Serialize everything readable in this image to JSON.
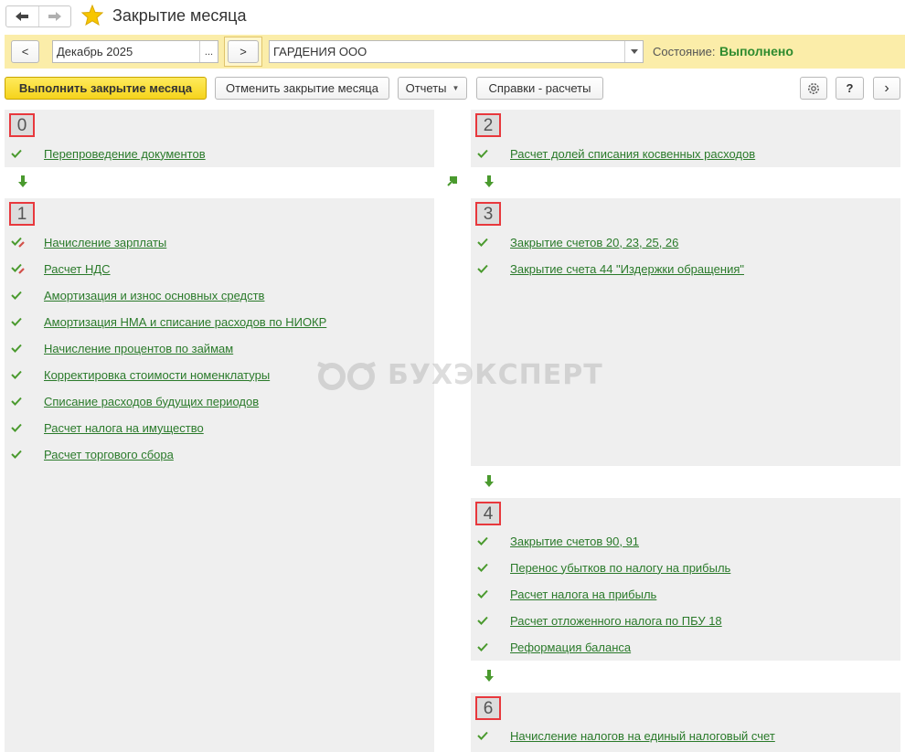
{
  "window": {
    "title": "Закрытие месяца",
    "favorite_icon": "star-icon"
  },
  "filter": {
    "period_value": "Декабрь 2025",
    "period_select": "...",
    "prev_label": "<",
    "next_label": ">",
    "organization_value": "ГАРДЕНИЯ ООО",
    "state_label": "Состояние:",
    "state_value": "Выполнено",
    "state_color": "#2e8b2e",
    "bar_color": "#fbeda9"
  },
  "toolbar": {
    "run_label": "Выполнить закрытие месяца",
    "cancel_label": "Отменить закрытие месяца",
    "reports_label": "Отчеты",
    "info_label": "Справки - расчеты",
    "help_label": "?",
    "more_label": "›"
  },
  "stages": {
    "s0": {
      "number": "0",
      "items": [
        {
          "label": "Перепроведение документов",
          "status": "check"
        }
      ]
    },
    "s1": {
      "number": "1",
      "items": [
        {
          "label": "Начисление зарплаты",
          "status": "check-edit"
        },
        {
          "label": "Расчет НДС",
          "status": "check-edit"
        },
        {
          "label": "Амортизация и износ основных средств",
          "status": "check"
        },
        {
          "label": "Амортизация НМА и списание расходов по НИОКР",
          "status": "check"
        },
        {
          "label": "Начисление процентов по займам",
          "status": "check"
        },
        {
          "label": "Корректировка стоимости номенклатуры",
          "status": "check"
        },
        {
          "label": "Списание расходов будущих периодов",
          "status": "check"
        },
        {
          "label": "Расчет налога на имущество",
          "status": "check"
        },
        {
          "label": "Расчет торгового сбора",
          "status": "check"
        }
      ]
    },
    "s2": {
      "number": "2",
      "items": [
        {
          "label": "Расчет долей списания косвенных расходов",
          "status": "check"
        }
      ]
    },
    "s3": {
      "number": "3",
      "items": [
        {
          "label": "Закрытие счетов 20, 23, 25, 26",
          "status": "check"
        },
        {
          "label": "Закрытие счета 44 \"Издержки обращения\"",
          "status": "check"
        }
      ]
    },
    "s4": {
      "number": "4",
      "items": [
        {
          "label": "Закрытие счетов 90, 91",
          "status": "check"
        },
        {
          "label": "Перенос убытков по налогу на прибыль",
          "status": "check"
        },
        {
          "label": "Расчет налога на прибыль",
          "status": "check"
        },
        {
          "label": "Расчет отложенного налога по ПБУ 18",
          "status": "check"
        },
        {
          "label": "Реформация баланса",
          "status": "check"
        }
      ]
    },
    "s6": {
      "number": "6",
      "items": [
        {
          "label": "Начисление налогов на единый налоговый счет",
          "status": "check"
        }
      ]
    }
  },
  "watermark": {
    "text": "БУХЭКСПЕРТ",
    "icon": "owl-eyes-icon"
  },
  "colors": {
    "panel_bg": "#efefef",
    "link": "#2a7a2a",
    "check": "#4a9a2e",
    "badge_border": "#e8383d",
    "primary_button": "#f5d31c"
  }
}
